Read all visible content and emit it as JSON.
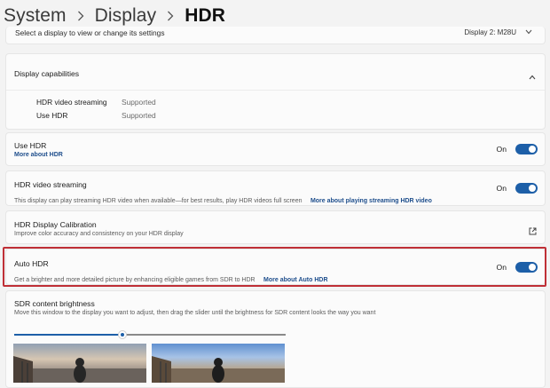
{
  "breadcrumb": {
    "items": [
      "System",
      "Display",
      "HDR"
    ]
  },
  "select_display": {
    "text": "Select a display to view or change its settings",
    "dropdown_value": "Display 2: M28U"
  },
  "capabilities": {
    "title": "Display capabilities",
    "rows": [
      {
        "label": "HDR video streaming",
        "value": "Supported"
      },
      {
        "label": "Use HDR",
        "value": "Supported"
      }
    ]
  },
  "use_hdr": {
    "title": "Use HDR",
    "link": "More about HDR",
    "state": "On"
  },
  "hdr_video": {
    "title": "HDR video streaming",
    "desc": "This display can play streaming HDR video when available—for best results, play HDR videos full screen",
    "link": "More about playing streaming HDR video",
    "state": "On"
  },
  "calibration": {
    "title": "HDR Display Calibration",
    "desc": "Improve color accuracy and consistency on your HDR display"
  },
  "auto_hdr": {
    "title": "Auto HDR",
    "desc": "Get a brighter and more detailed picture by enhancing eligible games from SDR to HDR",
    "link": "More about Auto HDR",
    "state": "On"
  },
  "sdr": {
    "title": "SDR content brightness",
    "desc": "Move this window to the display you want to adjust, then drag the slider until the brightness for SDR content looks the way you want",
    "brightness_fraction": 0.4
  },
  "colors": {
    "accent": "#1d5fa8",
    "highlight_border": "#bf2f36"
  },
  "icons": [
    "chevron-right-icon",
    "chevron-down-icon",
    "chevron-up-icon",
    "external-link-icon"
  ]
}
